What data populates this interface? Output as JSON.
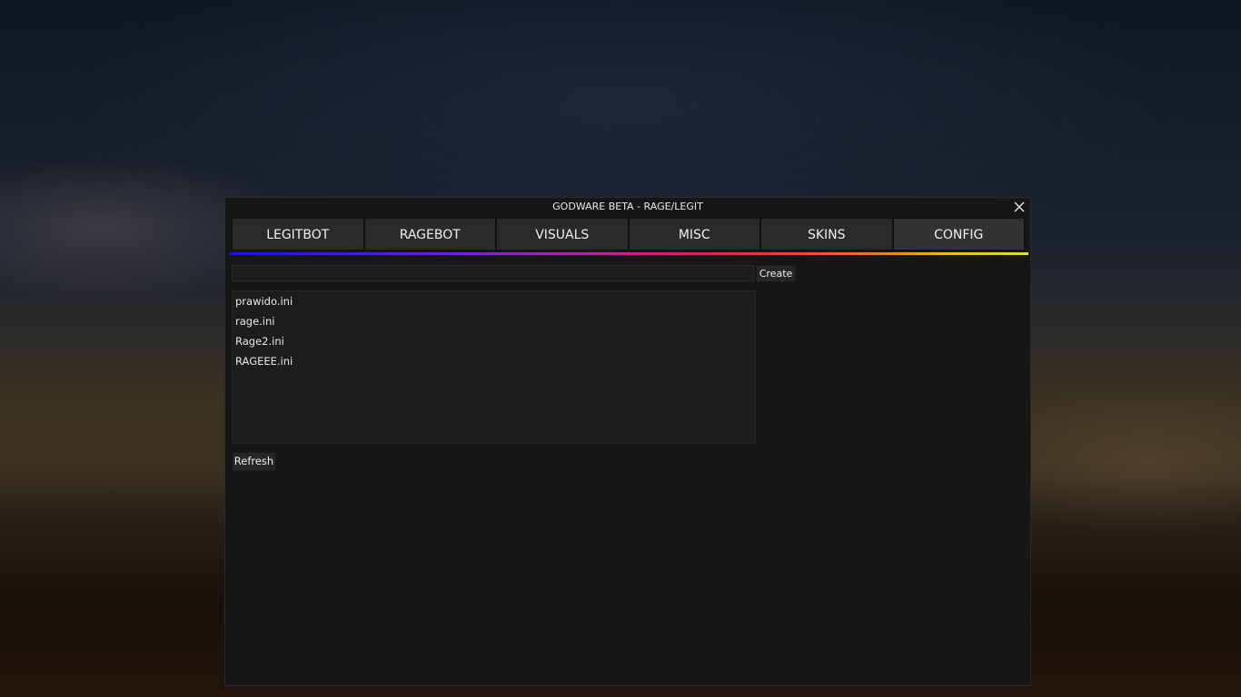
{
  "window": {
    "title": "GODWARE BETA - RAGE/LEGIT"
  },
  "tabs": [
    {
      "label": "LEGITBOT"
    },
    {
      "label": "RAGEBOT"
    },
    {
      "label": "VISUALS"
    },
    {
      "label": "MISC"
    },
    {
      "label": "SKINS"
    },
    {
      "label": "CONFIG"
    }
  ],
  "active_tab": "CONFIG",
  "config": {
    "name_input_value": "",
    "create_label": "Create",
    "refresh_label": "Refresh",
    "files": [
      {
        "name": "prawido.ini"
      },
      {
        "name": "rage.ini"
      },
      {
        "name": "Rage2.ini"
      },
      {
        "name": "RAGEEE.ini"
      }
    ]
  },
  "icons": {
    "close": "close-icon"
  },
  "colors": {
    "window_bg": "#161616",
    "tab_bg": "#2a2a2a",
    "accent_gradient": [
      "#1b14d6",
      "#b020b8",
      "#e02a4a",
      "#f57e18",
      "#d8e628"
    ]
  }
}
